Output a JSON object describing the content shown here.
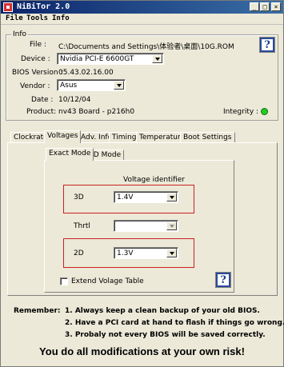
{
  "window": {
    "title": "NiBiTor 2.0",
    "controls": {
      "minimize": "_",
      "maximize": "□",
      "close": "×"
    }
  },
  "menu": {
    "items": [
      "File",
      "Tools",
      "Info"
    ]
  },
  "info": {
    "legend": "Info",
    "file_label": "File :",
    "file_value": "C:\\Documents and Settings\\体验者\\桌面\\10G.ROM",
    "device_label": "Device :",
    "device_value": "Nvidia PCI-E 6600GT",
    "bios_label": "BIOS Version :",
    "bios_value": "05.43.02.16.00",
    "vendor_label": "Vendor :",
    "vendor_value": "Asus",
    "date_label": "Date :",
    "date_value": "10/12/04",
    "product_label": "Product:",
    "product_value": "nv43 Board - p216h0",
    "integrity_label": "Integrity :",
    "integrity_color": "#22cc22",
    "help_label": "?"
  },
  "tabs": {
    "items": [
      "Clockrates",
      "Voltages",
      "Adv. Info",
      "Timings",
      "Temperatures",
      "Boot Settings"
    ],
    "active": "Voltages"
  },
  "subtabs": {
    "items": [
      "Exact Mode",
      "VID Mode"
    ],
    "active": "Exact Mode"
  },
  "voltage": {
    "header": "Voltage identifier",
    "rows": [
      {
        "label": "3D",
        "value": "1.4V"
      },
      {
        "label": "Thrtl",
        "value": ""
      },
      {
        "label": "2D",
        "value": "1.3V"
      }
    ],
    "extend_label": "Extend Volage Table",
    "extend_checked": false,
    "help_label": "?",
    "highlight_color": "#cc2020"
  },
  "footer": {
    "remember_label": "Remember:",
    "tips": [
      "1. Always keep a clean backup of your old BIOS.",
      "2. Have a PCI card at hand to flash if things go wrong.",
      "3. Probaly not every BIOS will be saved correctly."
    ],
    "warning": "You do all modifications at your own risk!"
  }
}
